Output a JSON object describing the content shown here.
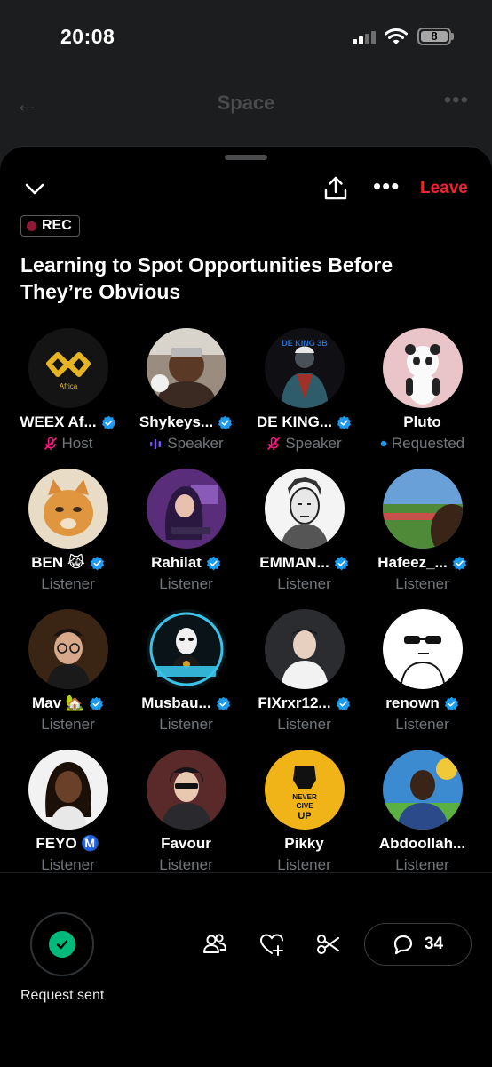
{
  "status_bar": {
    "time": "20:08",
    "battery": "8"
  },
  "underlying_page": {
    "title": "Space"
  },
  "header": {
    "leave_label": "Leave"
  },
  "rec_badge": "REC",
  "space_title": "Learning to Spot Opportunities Before They’re Obvious",
  "participants": [
    {
      "name": "WEEX Af...",
      "role": "Host",
      "role_icon": "mic-off-icon",
      "verified": true,
      "avatar": "weex"
    },
    {
      "name": "Shykeys...",
      "role": "Speaker",
      "role_icon": "speaking-bars-icon",
      "verified": true,
      "avatar": "photo-man"
    },
    {
      "name": "DE KING...",
      "role": "Speaker",
      "role_icon": "mic-off-icon",
      "verified": true,
      "avatar": "king"
    },
    {
      "name": "Pluto",
      "role": "Requested",
      "role_icon": "requested-dot-icon",
      "verified": false,
      "avatar": "panda"
    },
    {
      "name": "BEN 😹",
      "role": "Listener",
      "role_icon": "",
      "verified": true,
      "avatar": "cat"
    },
    {
      "name": "Rahilat",
      "role": "Listener",
      "role_icon": "",
      "verified": true,
      "avatar": "anime-girl"
    },
    {
      "name": "EMMAN...",
      "role": "Listener",
      "role_icon": "",
      "verified": true,
      "avatar": "sketch"
    },
    {
      "name": "Hafeez_...",
      "role": "Listener",
      "role_icon": "",
      "verified": true,
      "avatar": "field"
    },
    {
      "name": "Mav 🏡",
      "role": "Listener",
      "role_icon": "",
      "verified": true,
      "avatar": "glasses"
    },
    {
      "name": "Musbau...",
      "role": "Listener",
      "role_icon": "",
      "verified": true,
      "avatar": "mask"
    },
    {
      "name": "FIXrxr12...",
      "role": "Listener",
      "role_icon": "",
      "verified": true,
      "avatar": "boy"
    },
    {
      "name": "renown",
      "role": "Listener",
      "role_icon": "",
      "verified": true,
      "avatar": "meme"
    },
    {
      "name": "FEYO Ⓜ️",
      "role": "Listener",
      "role_icon": "",
      "verified": false,
      "avatar": "girl"
    },
    {
      "name": "Favour",
      "role": "Listener",
      "role_icon": "",
      "verified": false,
      "avatar": "anime-guy"
    },
    {
      "name": "Pikky",
      "role": "Listener",
      "role_icon": "",
      "verified": false,
      "avatar": "fist"
    },
    {
      "name": "Abdoollah...",
      "role": "Listener",
      "role_icon": "",
      "verified": false,
      "avatar": "young-man"
    }
  ],
  "bottom_bar": {
    "request_label": "Request sent",
    "comment_count": "34"
  },
  "colors": {
    "leave": "#f4212e",
    "verified": "#1d9bf0",
    "request_check": "#00ba7c",
    "host_mic_off": "#f91880",
    "speaking": "#7856ff"
  }
}
